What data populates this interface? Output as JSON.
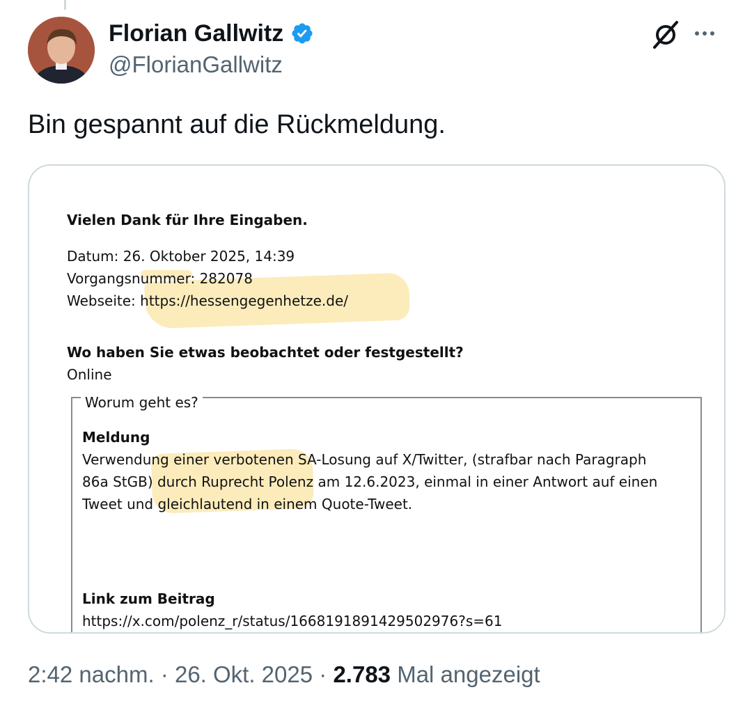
{
  "author": {
    "display_name": "Florian Gallwitz",
    "handle": "@FlorianGallwitz",
    "verified": true,
    "verified_color": "#1d9bf0"
  },
  "tweet": {
    "text": "Bin gespannt auf die Rückmeldung."
  },
  "icons": {
    "grok": "grok-icon",
    "more": "more-icon",
    "verified": "verified-badge-icon"
  },
  "document": {
    "heading": "Vielen Dank für Ihre Eingaben.",
    "date_line": "Datum: 26. Oktober 2025, 14:39",
    "case_line": "Vorgangsnummer: 282078",
    "website_label": "Webseite:",
    "website_url": "https://hessengegenhetze.de/",
    "question": "Wo haben Sie etwas beobachtet oder festgestellt?",
    "answer": "Online",
    "fieldset_legend": "Worum geht es?",
    "report_title": "Meldung",
    "report_lines": [
      "Verwendung einer verbotenen SA-Losung auf X/Twitter, (strafbar nach Paragraph",
      "86a StGB) durch Ruprecht Polenz am 12.6.2023, einmal in einer Antwort auf einen",
      "Tweet und gleichlautend in einem Quote-Tweet."
    ],
    "link_title": "Link zum Beitrag",
    "link_url": "https://x.com/polenz_r/status/1668191891429502976?s=61",
    "highlight_color": "#fbe5a6"
  },
  "footer": {
    "time": "2:42 nachm.",
    "sep1": "·",
    "date": "26. Okt. 2025",
    "sep2": "·",
    "views_count": "2.783",
    "views_label": "Mal angezeigt"
  }
}
